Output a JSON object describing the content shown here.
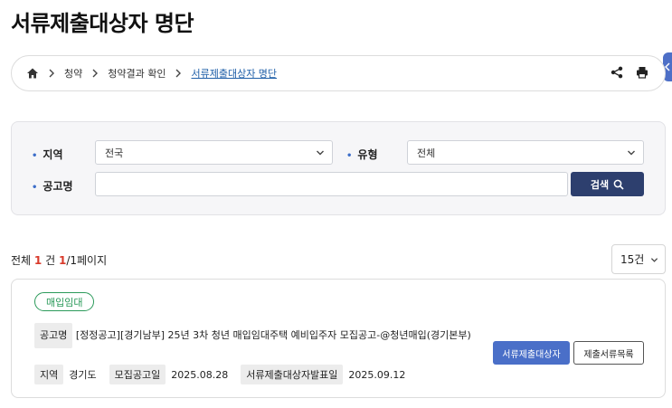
{
  "page": {
    "title": "서류제출대상자 명단"
  },
  "breadcrumb": {
    "items": [
      "청약",
      "청약결과 확인"
    ],
    "current": "서류제출대상자 명단",
    "home_icon": "home-icon",
    "share_icon": "share-icon",
    "print_icon": "print-icon"
  },
  "filters": {
    "region": {
      "label": "지역",
      "value": "전국"
    },
    "type": {
      "label": "유형",
      "value": "전체"
    },
    "notice": {
      "label": "공고명",
      "placeholder": ""
    },
    "search_label": "검색"
  },
  "summary": {
    "prefix": "전체",
    "count": "1",
    "count_unit": "건",
    "current_page": "1",
    "page_suffix": "/1페이지"
  },
  "page_size": {
    "value": "15건"
  },
  "results": [
    {
      "badge": "매입임대",
      "title_tag": "공고명",
      "title": "[정정공고][경기남부] 25년 3차 청년 매입임대주택 예비입주자 모집공고-@청년매입(경기본부)",
      "region_tag": "지역",
      "region": "경기도",
      "notice_date_tag": "모집공고일",
      "notice_date": "2025.08.28",
      "announce_date_tag": "서류제출대상자발표일",
      "announce_date": "2025.09.12",
      "primary_button": "서류제출대상자",
      "secondary_button": "제출서류목록"
    }
  ],
  "colors": {
    "accent": "#2d3f6e",
    "primary_button": "#4a6fc8",
    "badge": "#2b9a5a",
    "count_highlight": "#d93a2b",
    "breadcrumb_link": "#1f5fa8"
  }
}
